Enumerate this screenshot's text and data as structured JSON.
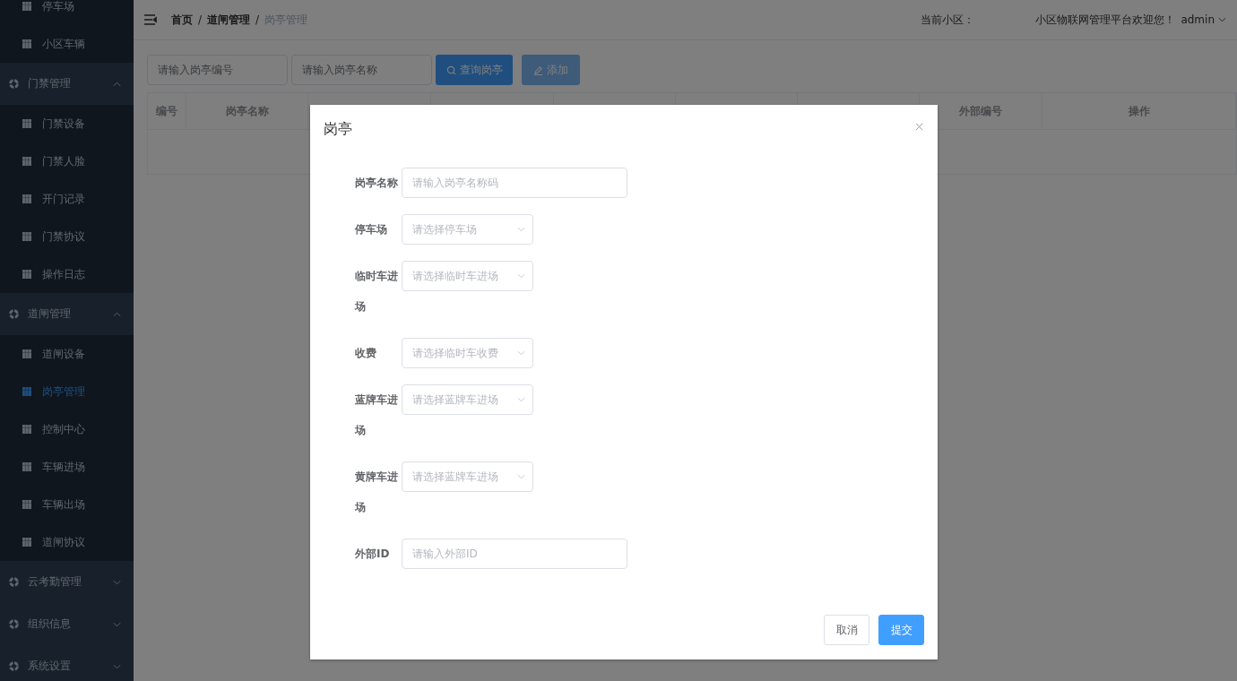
{
  "sidebar": {
    "items": [
      {
        "kind": "sub",
        "label": "停车场",
        "selected": false
      },
      {
        "kind": "sub",
        "label": "小区车辆",
        "selected": false
      },
      {
        "kind": "group",
        "label": "门禁管理",
        "expanded": true,
        "children": [
          {
            "kind": "sub",
            "label": "门禁设备",
            "selected": false
          },
          {
            "kind": "sub",
            "label": "门禁人脸",
            "selected": false
          },
          {
            "kind": "sub",
            "label": "开门记录",
            "selected": false
          },
          {
            "kind": "sub",
            "label": "门禁协议",
            "selected": false
          },
          {
            "kind": "sub",
            "label": "操作日志",
            "selected": false
          }
        ]
      },
      {
        "kind": "group",
        "label": "道闸管理",
        "expanded": true,
        "children": [
          {
            "kind": "sub",
            "label": "道闸设备",
            "selected": false
          },
          {
            "kind": "sub",
            "label": "岗亭管理",
            "selected": true
          },
          {
            "kind": "sub",
            "label": "控制中心",
            "selected": false
          },
          {
            "kind": "sub",
            "label": "车辆进场",
            "selected": false
          },
          {
            "kind": "sub",
            "label": "车辆出场",
            "selected": false
          },
          {
            "kind": "sub",
            "label": "道闸协议",
            "selected": false
          }
        ]
      },
      {
        "kind": "group",
        "label": "云考勤管理",
        "expanded": false
      },
      {
        "kind": "group",
        "label": "组织信息",
        "expanded": false
      },
      {
        "kind": "group",
        "label": "系统设置",
        "expanded": false
      }
    ]
  },
  "header": {
    "breadcrumb": {
      "separator": "/",
      "items": [
        {
          "label": "首页",
          "current": false
        },
        {
          "label": "道闸管理",
          "current": false
        },
        {
          "label": "岗亭管理",
          "current": true
        }
      ]
    },
    "community_label": "当前小区：",
    "welcome": "小区物联网管理平台欢迎您！",
    "user": "admin"
  },
  "toolbar": {
    "fields": [
      {
        "placeholder": "请输入岗亭编号"
      },
      {
        "placeholder": "请输入岗亭名称"
      }
    ],
    "buttons": [
      {
        "kind": "primary",
        "label": "查询岗亭"
      },
      {
        "kind": "light",
        "label": "添加"
      }
    ]
  },
  "table": {
    "columns": [
      "编号",
      "岗亭名称",
      "外部编号",
      "操作"
    ]
  },
  "dialog": {
    "title": "岗亭",
    "fields": [
      {
        "kind": "input",
        "label": "岗亭名称",
        "placeholder": "请输入岗亭名称码"
      },
      {
        "kind": "select",
        "label": "停车场",
        "placeholder": "请选择停车场"
      },
      {
        "kind": "select",
        "label": "临时车进场",
        "placeholder": "请选择临时车进场"
      },
      {
        "kind": "select",
        "label": "收费",
        "placeholder": "请选择临时车收费"
      },
      {
        "kind": "select",
        "label": "蓝牌车进场",
        "placeholder": "请选择蓝牌车进场"
      },
      {
        "kind": "select",
        "label": "黄牌车进场",
        "placeholder": "请选择蓝牌车进场"
      },
      {
        "kind": "input",
        "label": "外部ID",
        "placeholder": "请输入外部ID"
      }
    ],
    "buttons": [
      {
        "kind": "default",
        "label": "取消"
      },
      {
        "kind": "primary",
        "label": "提交"
      }
    ]
  }
}
